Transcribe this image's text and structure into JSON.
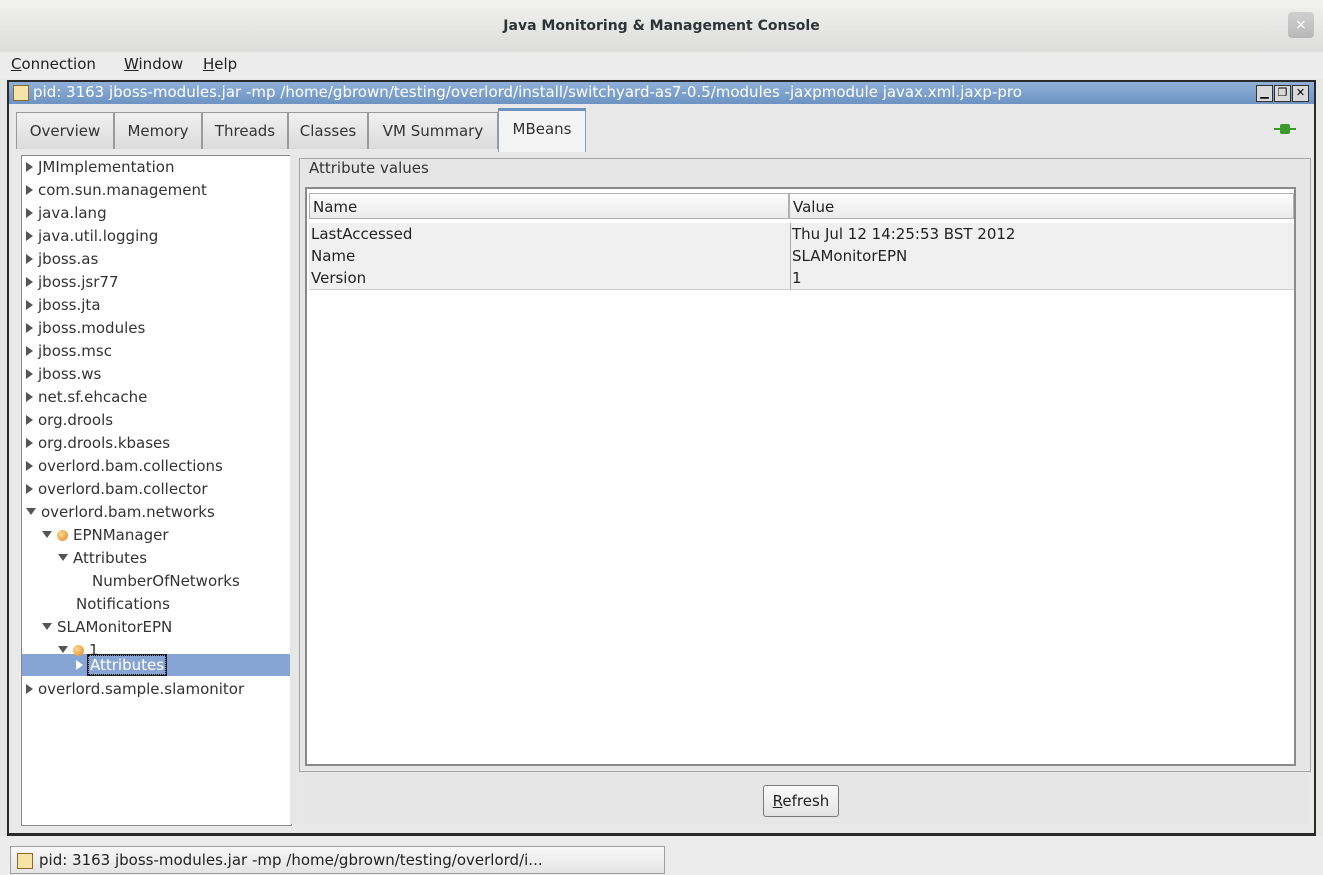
{
  "window": {
    "title": "Java Monitoring & Management Console",
    "close_glyph": "×"
  },
  "menubar": {
    "items": [
      "Connection",
      "Window",
      "Help"
    ]
  },
  "internal_frame": {
    "title": "pid: 3163 jboss-modules.jar -mp /home/gbrown/testing/overlord/install/switchyard-as7-0.5/modules -jaxpmodule javax.xml.jaxp-pro",
    "minimize_glyph": "▁",
    "restore_glyph": "❐",
    "close_glyph": "✕"
  },
  "tabs": [
    "Overview",
    "Memory",
    "Threads",
    "Classes",
    "VM Summary",
    "MBeans"
  ],
  "active_tab": "MBeans",
  "tree": {
    "nodes": [
      "JMImplementation",
      "com.sun.management",
      "java.lang",
      "java.util.logging",
      "jboss.as",
      "jboss.jsr77",
      "jboss.jta",
      "jboss.modules",
      "jboss.msc",
      "jboss.ws",
      "net.sf.ehcache",
      "org.drools",
      "org.drools.kbases",
      "overlord.bam.collections",
      "overlord.bam.collector",
      "overlord.bam.networks",
      "EPNManager",
      "Attributes",
      "NumberOfNetworks",
      "Notifications",
      "SLAMonitorEPN",
      "1",
      "Attributes",
      "overlord.sample.slamonitor"
    ],
    "selected": "Attributes"
  },
  "attributes": {
    "legend": "Attribute values",
    "columns": [
      "Name",
      "Value"
    ],
    "rows": [
      {
        "name": "LastAccessed",
        "value": "Thu Jul 12 14:25:53 BST 2012"
      },
      {
        "name": "Name",
        "value": "SLAMonitorEPN"
      },
      {
        "name": "Version",
        "value": "1"
      }
    ],
    "refresh_label": "Refresh"
  },
  "taskbar": {
    "item": "pid: 3163 jboss-modules.jar -mp /home/gbrown/testing/overlord/i..."
  },
  "colors": {
    "selection": "#86a5d4",
    "frame_title": "#6d93c3",
    "connected": "#3a9a2a"
  },
  "icons": {
    "connection": "plug-connected-icon",
    "mbean": "bean-icon",
    "app": "java-cup-icon"
  }
}
